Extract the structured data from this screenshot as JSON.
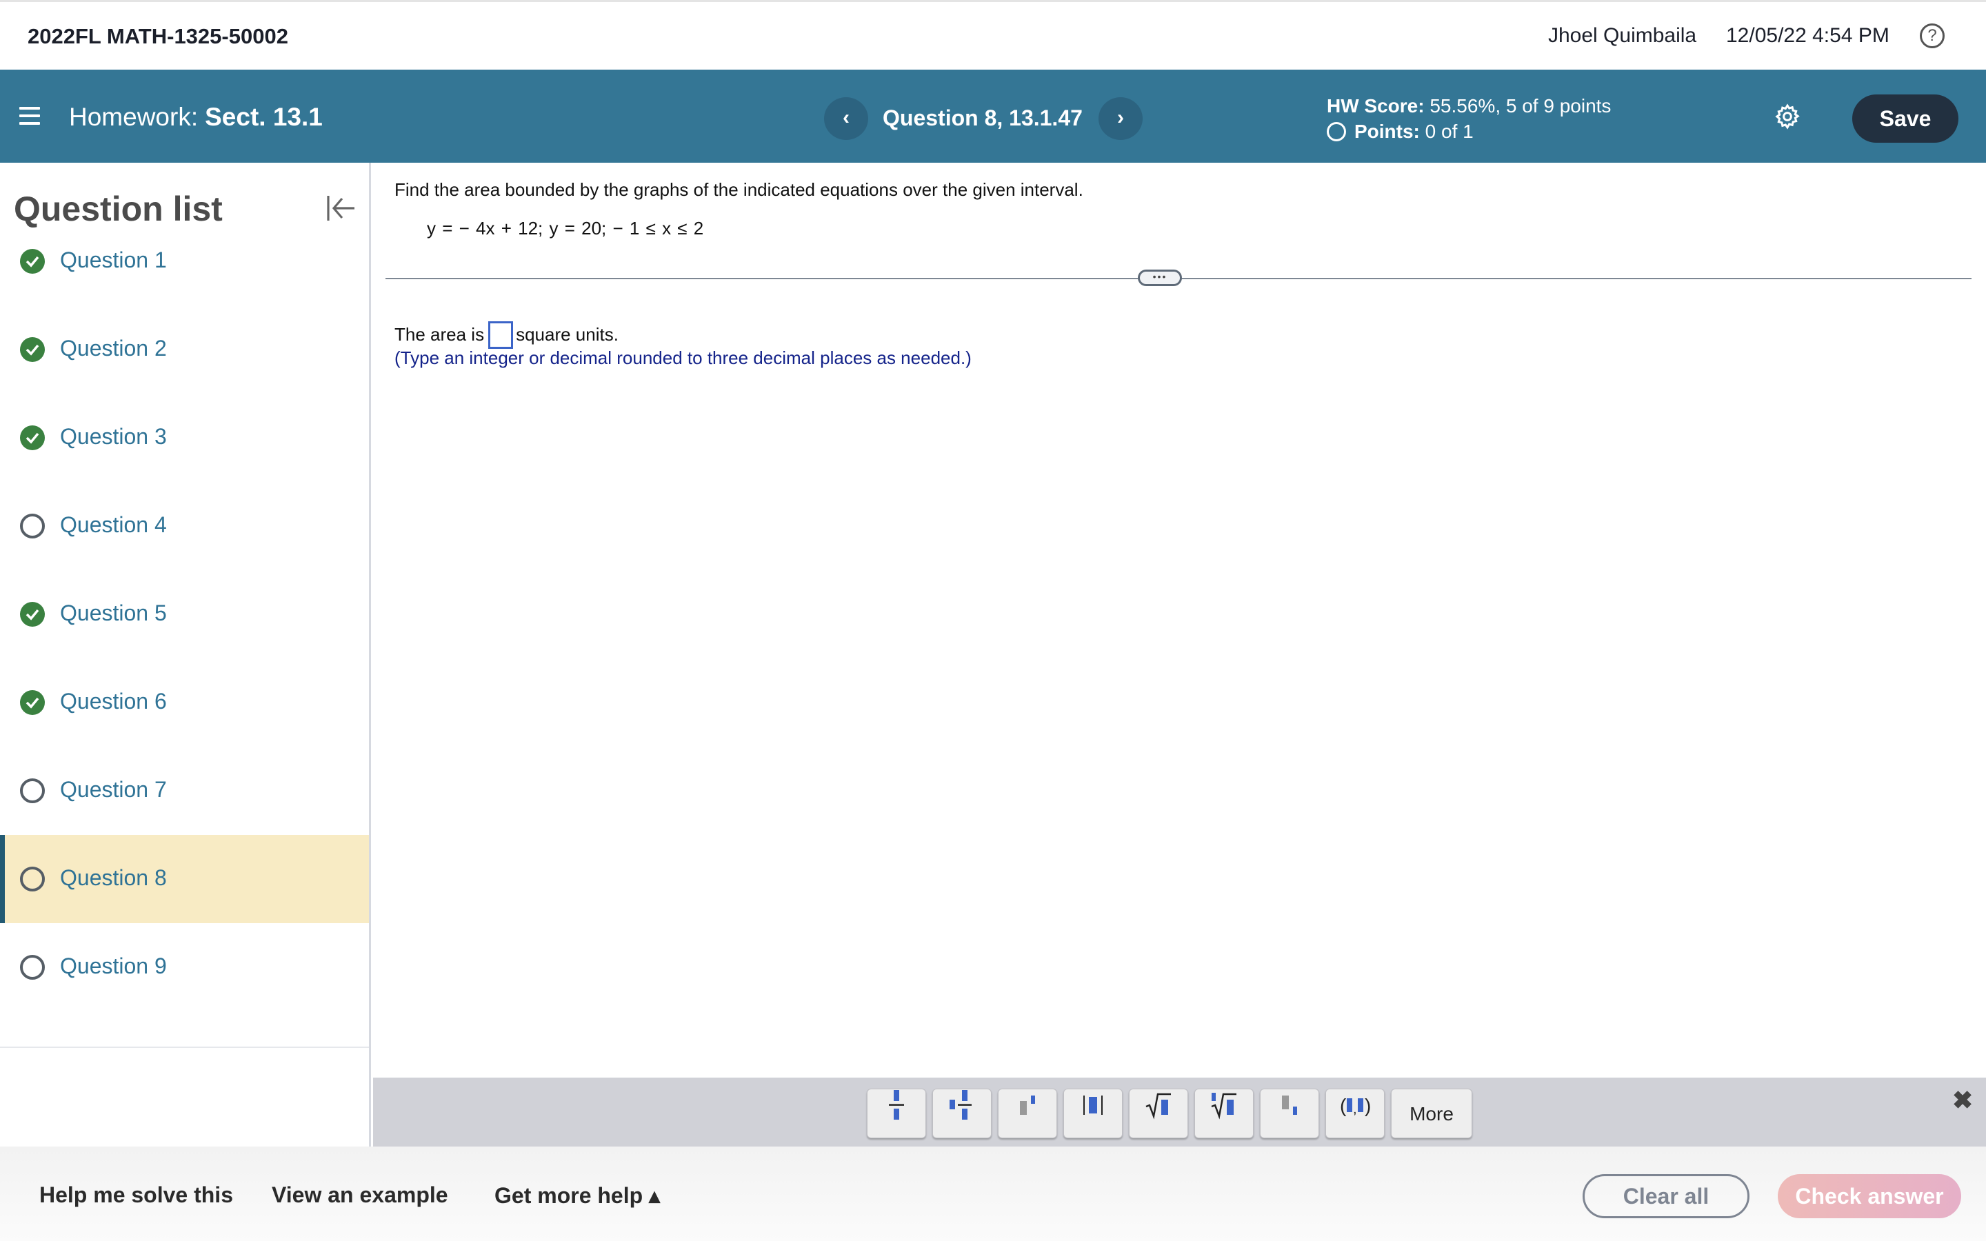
{
  "topbar": {
    "course": "2022FL MATH-1325-50002",
    "user": "Jhoel Quimbaila",
    "datetime": "12/05/22 4:54 PM",
    "help_icon": "help-circle-icon"
  },
  "header": {
    "hw_prefix": "Homework:",
    "hw_name": "Sect. 13.1",
    "prev_label": "‹",
    "next_label": "›",
    "question_title": "Question 8, 13.1.47",
    "score_label": "HW Score:",
    "score_value": "55.56%, 5 of 9 points",
    "points_label": "Points:",
    "points_value": "0 of 1",
    "save_label": "Save",
    "accent_color": "#347695"
  },
  "sidebar": {
    "title": "Question list",
    "items": [
      {
        "label": "Question 1",
        "status": "done"
      },
      {
        "label": "Question 2",
        "status": "done"
      },
      {
        "label": "Question 3",
        "status": "done"
      },
      {
        "label": "Question 4",
        "status": "todo"
      },
      {
        "label": "Question 5",
        "status": "done"
      },
      {
        "label": "Question 6",
        "status": "done"
      },
      {
        "label": "Question 7",
        "status": "todo"
      },
      {
        "label": "Question 8",
        "status": "todo",
        "active": true
      },
      {
        "label": "Question 9",
        "status": "todo"
      }
    ]
  },
  "question": {
    "instruction": "Find the area bounded by the graphs of the indicated equations over the given interval.",
    "equation": "y = − 4x + 12; y = 20;  − 1 ≤ x ≤ 2",
    "answer_prefix": "The area is",
    "answer_value": "",
    "answer_suffix": "square units.",
    "hint": "(Type an integer or decimal rounded to three decimal places as needed.)",
    "divider_pill": "•••"
  },
  "mathbar": {
    "buttons": [
      "fraction",
      "mixed-number",
      "exponent",
      "absolute-value",
      "square-root",
      "nth-root",
      "subscript",
      "ordered-pair"
    ],
    "more_label": "More",
    "close_label": "✖"
  },
  "bottombar": {
    "help_solve": "Help me solve this",
    "view_example": "View an example",
    "more_help": "Get more help ▴",
    "clear_all": "Clear all",
    "check_answer": "Check answer"
  }
}
